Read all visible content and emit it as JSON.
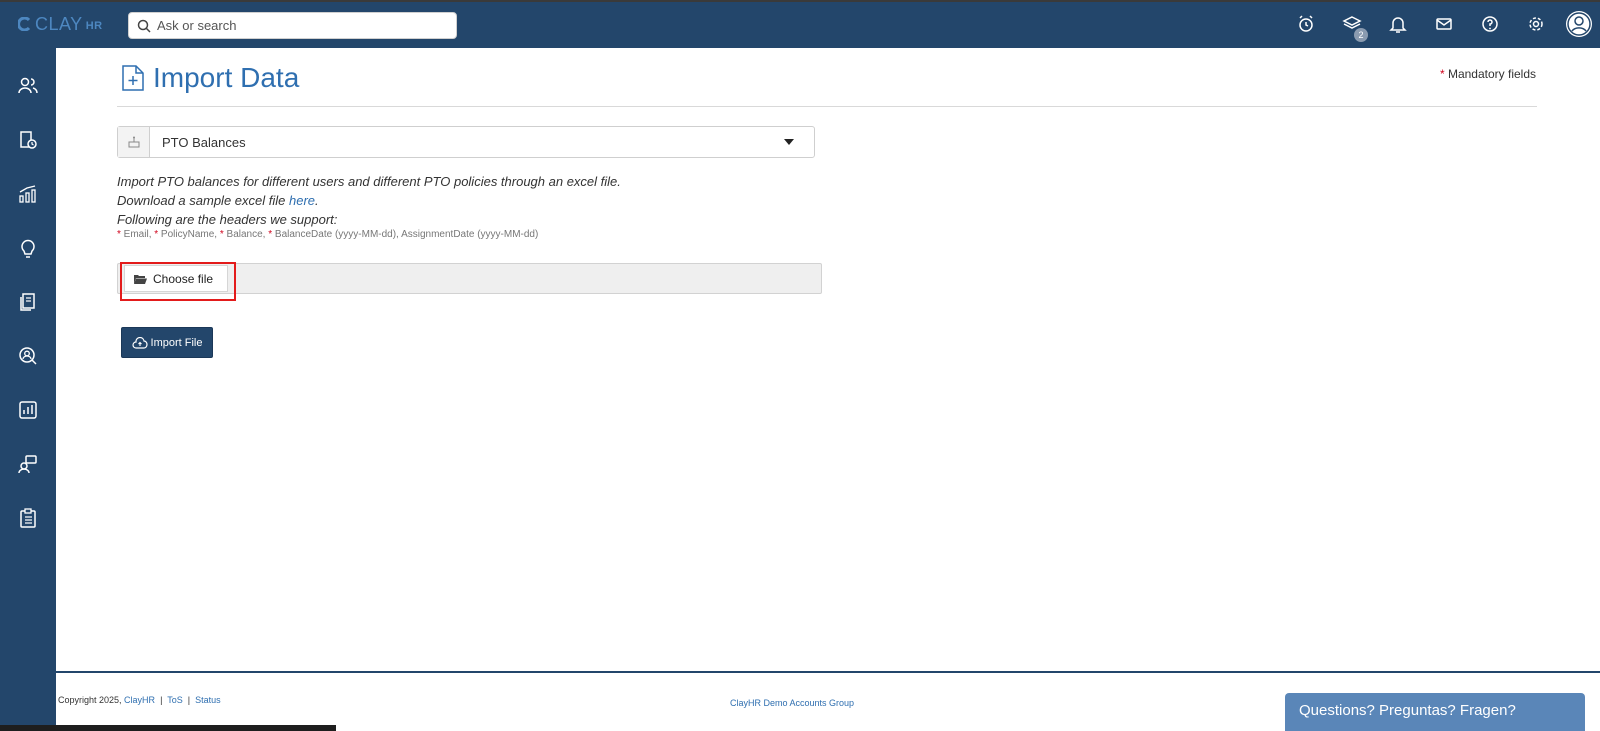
{
  "app": {
    "logo_text": "CLAY",
    "logo_suffix": "HR"
  },
  "search": {
    "placeholder": "Ask or search"
  },
  "top_icons": [
    "alarm-clock-icon",
    "layers-icon",
    "bell-icon",
    "mail-icon",
    "help-icon",
    "gear-icon",
    "user-avatar-icon"
  ],
  "notifications": {
    "layers_badge": "2"
  },
  "sidebar": {
    "items": [
      "users-icon",
      "document-clock-icon",
      "analytics-icon",
      "lightbulb-icon",
      "documents-icon",
      "search-user-icon",
      "report-icon",
      "support-icon",
      "clipboard-icon"
    ]
  },
  "page": {
    "title": "Import Data",
    "mandatory_star": "*",
    "mandatory_label": "Mandatory fields"
  },
  "import_type": {
    "selected": "PTO Balances"
  },
  "description": {
    "line1": "Import PTO balances for different users and different PTO policies through an excel file.",
    "line2_prefix": "Download a sample excel file ",
    "line2_link": "here",
    "line2_suffix": ".",
    "line3": "Following are the headers we support:"
  },
  "headers_support": {
    "star": "*",
    "email": " Email, ",
    "policy": " PolicyName, ",
    "balance": " Balance, ",
    "rest": " BalanceDate (yyyy-MM-dd), AssignmentDate (yyyy-MM-dd)"
  },
  "file": {
    "choose_label": "Choose file"
  },
  "import_button": {
    "label": "Import File"
  },
  "footer": {
    "copyright": "Copyright 2025, ",
    "company_link": "ClayHR",
    "tos": "ToS",
    "status": "Status",
    "separator": "|",
    "group": "ClayHR Demo Accounts Group"
  },
  "chat": {
    "label": "Questions? Preguntas? Fragen?"
  },
  "colors": {
    "primary": "#23466b",
    "link": "#2f6fb0",
    "highlight": "#e31b1b",
    "chat": "#5a86b8"
  }
}
